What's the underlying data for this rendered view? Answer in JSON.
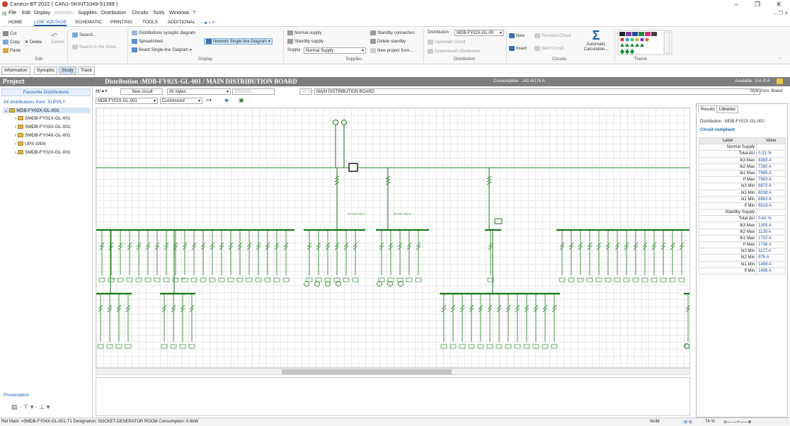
{
  "window": {
    "title": "Caneco-BT 2022 ( CAN1-SKINT1049-51399 )",
    "min_glyph": "–",
    "max_glyph": "❐",
    "close_glyph": "✕",
    "sub_controls": "– ❐ ✕"
  },
  "menu": {
    "items": [
      "File",
      "Edit",
      "Display",
      "Insertion",
      "Supplies",
      "Distribution",
      "Circuits",
      "Tools",
      "Windows",
      "?"
    ]
  },
  "ribbon_tabs": [
    "HOME",
    "LOW VOLTAGE",
    "SCHEMATIC",
    "PRINTING",
    "TOOLS",
    "ADDITIONAL"
  ],
  "ribbon": {
    "edit": {
      "cut": "Cut",
      "copy": "Copy",
      "delete": "Delete",
      "paste": "Paste",
      "cancel": "Cancel",
      "group": "Edit"
    },
    "search": {
      "search": "Search...",
      "search_sheet": "Search in the sheet..."
    },
    "display": {
      "synoptic": "Distributions synoptic diagram",
      "spreadsheet": "Spreadsheet",
      "board_single": "Board Single-line Diagram",
      "network_single": "Network Single-line Diagram",
      "group": "Display"
    },
    "supplies": {
      "normal": "Normal supply",
      "standby": "Standby supply",
      "supply_label": "Supply",
      "supply_value": "Normal Supply",
      "standby_conn": "Standby connection",
      "delete_standby": "Delete standby",
      "new_project": "New project from...",
      "group": "Supplies"
    },
    "distribution": {
      "label": "Distribution",
      "value": "MDB-FY02X-GL-00",
      "upstream": "Upstream circuit",
      "downstream": "Downstream distribution",
      "group": "Distribution"
    },
    "circuits": {
      "new": "New",
      "insert": "Insert",
      "previous": "Previous Circuit",
      "next": "Next Circuit",
      "auto_calc": "Automatic Calculation...",
      "group": "Circuits"
    },
    "theme": {
      "group": "Theme"
    }
  },
  "view_tabs": [
    "Information",
    "Synoptic",
    "Study",
    "Track"
  ],
  "active_view_tab": "Study",
  "header": {
    "project": "Project",
    "distribution": "Distribution :MDB-FY02X-GL-001 / MAIN DISTRIBUTION BOARD",
    "consumption": "Consumption : 142 A/174 A",
    "available": "Available : 0 A /0 A"
  },
  "left_panel": {
    "favourites": "Favourite Distributions",
    "all_from": "All distributions from: SUPPLY",
    "root": "MDB-FY02X-GL-001",
    "children": [
      "SMDB-FY01X-GL-001",
      "SMDB-FY03X-GL-001",
      "SMDB-FY04X-GL-001",
      "UPS-GEN",
      "SMDB-FY02X-GL-001"
    ],
    "presentation": "Presentation"
  },
  "toolbar": {
    "new_circuit": "New circuit",
    "styles_value": "All styles",
    "power_value": "2000kVA",
    "length_value": "10 m",
    "board_name": "MAIN DISTRIBUTION BOARD",
    "style_from": "Style from: Board",
    "dist_value": "MDB-FY02X-GL-001",
    "view_value": "Customized"
  },
  "results": {
    "tabs": [
      "Results",
      "Libraries"
    ],
    "distribution": "Distribution : MDB-FY02X-GL-001",
    "status": "Circuit compliant",
    "col_label": "Label",
    "col_value": "Value",
    "rows": [
      {
        "label": "Normal Supply",
        "value": ""
      },
      {
        "label": "Total ΔU",
        "value": "0.31 %"
      },
      {
        "label": "Ik3 Max",
        "value": "8383 A"
      },
      {
        "label": "Ik2 Max",
        "value": "7260 A"
      },
      {
        "label": "Ik1 Max",
        "value": "7985 A"
      },
      {
        "label": "If Max",
        "value": "7883 A"
      },
      {
        "label": "Ik3 Min",
        "value": "6972 A"
      },
      {
        "label": "Ik2 Min",
        "value": "6038 A"
      },
      {
        "label": "Ik1 Min",
        "value": "6663 A"
      },
      {
        "label": "If Min",
        "value": "6518 A"
      },
      {
        "label": "Standby Supply",
        "value": ""
      },
      {
        "label": "Total ΔU",
        "value": "0.62 %"
      },
      {
        "label": "Ik3 Max",
        "value": "1305 A"
      },
      {
        "label": "Ik2 Max",
        "value": "1130 A"
      },
      {
        "label": "Ik1 Max",
        "value": "1737 A"
      },
      {
        "label": "If Max",
        "value": "1736 A"
      },
      {
        "label": "Ik3 Min",
        "value": "1127 A"
      },
      {
        "label": "Ik2 Min",
        "value": "976 A"
      },
      {
        "label": "Ik1 Min",
        "value": "1499 A"
      },
      {
        "label": "If Min",
        "value": "1496 A"
      }
    ]
  },
  "status_bar": {
    "text": "Ref Mark: =SMDB-FY04X-GL-001-T1 Designation: SOCKET-GENERATOR ROOM Consumption: 0.6kW",
    "num": "NUM",
    "zoom": "74 %"
  },
  "colors": {
    "accent": "#1d5ea8",
    "diagram_line": "#1a7a1a",
    "header_bg": "#7d7d7d"
  },
  "diagram_labels": {
    "stubs_row1": "20AM",
    "stubs_row2": "10A",
    "mini_text": "Sub-Main cable 4c"
  }
}
